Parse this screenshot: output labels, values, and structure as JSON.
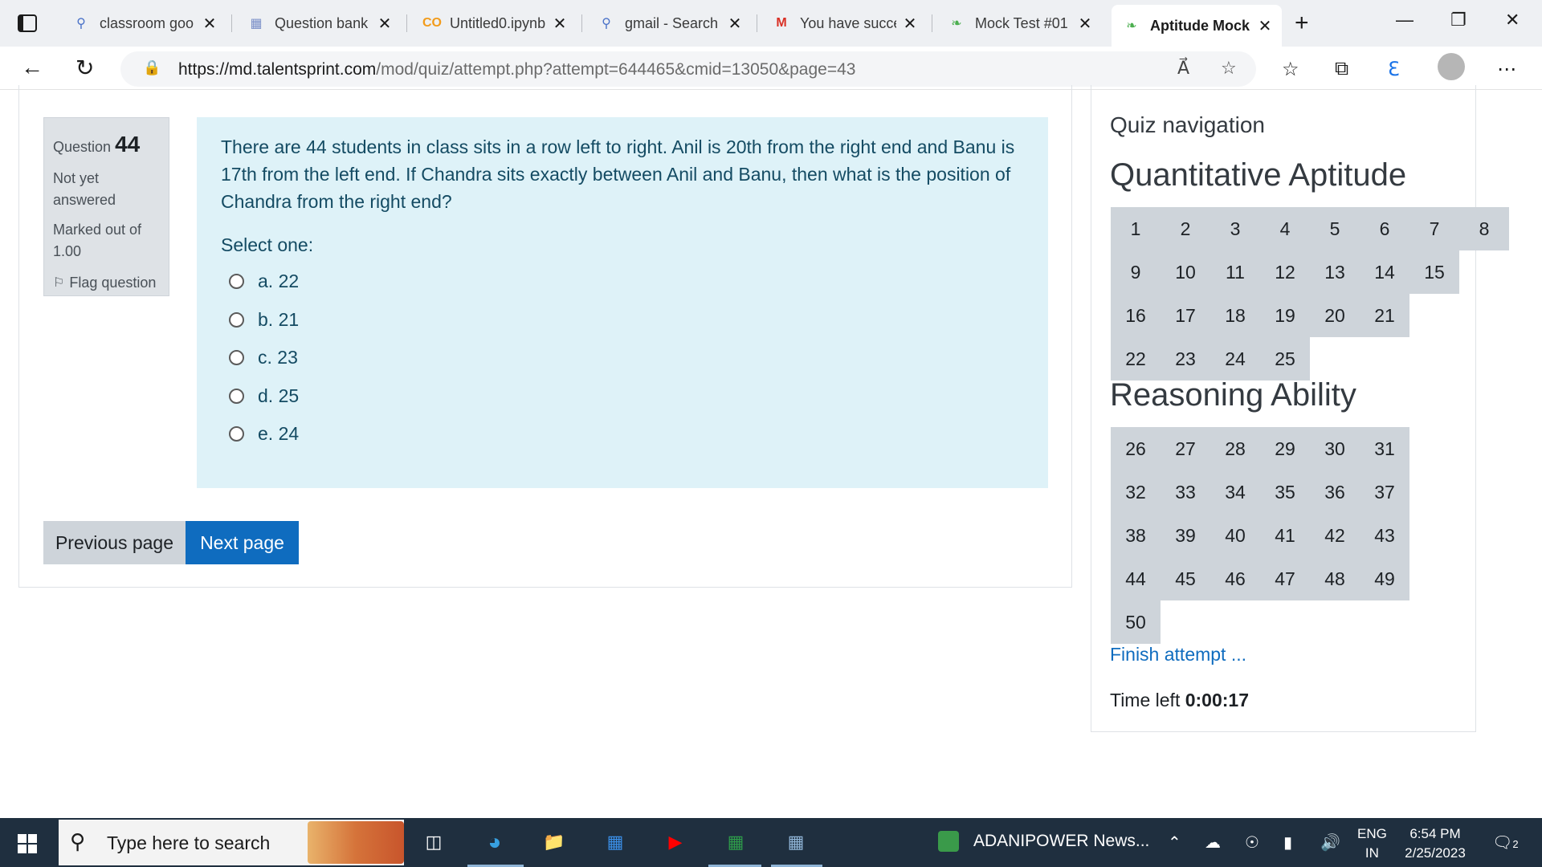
{
  "browser": {
    "tabs": [
      {
        "icon": "search-icon",
        "label": "classroom goo",
        "active": false
      },
      {
        "icon": "question-bank-icon",
        "label": "Question bank",
        "active": false
      },
      {
        "icon": "colab-icon",
        "label": "Untitled0.ipynb",
        "active": false
      },
      {
        "icon": "search-icon",
        "label": "gmail - Search",
        "active": false
      },
      {
        "icon": "gmail-icon",
        "label": "You have succe",
        "active": false
      },
      {
        "icon": "talentsprint-icon",
        "label": "Mock Test #01",
        "active": false
      },
      {
        "icon": "talentsprint-icon",
        "label": "Aptitude Mock",
        "active": true
      }
    ],
    "url_host": "https://md.talentsprint.com",
    "url_path": "/mod/quiz/attempt.php?attempt=644465&cmid=13050&page=43"
  },
  "question": {
    "label": "Question",
    "number": "44",
    "status": "Not yet answered",
    "marked": "Marked out of 1.00",
    "flag_label": "Flag question",
    "text": "There are 44 students in class sits in a row left to right. Anil is 20th from the right end and Banu is 17th from the left end. If Chandra sits exactly between Anil and Banu, then what is the position of Chandra from the right end?",
    "prompt": "Select one:",
    "answers": [
      "a. 22",
      "b. 21",
      "c. 23",
      "d. 25",
      "e. 24"
    ]
  },
  "buttons": {
    "previous": "Previous page",
    "next": "Next page"
  },
  "quiz_nav": {
    "title": "Quiz navigation",
    "sections": [
      {
        "title": "Quantitative Aptitude",
        "rows": [
          [
            "1",
            "2",
            "3",
            "4",
            "5",
            "6",
            "7",
            "8"
          ],
          [
            "9",
            "10",
            "11",
            "12",
            "13",
            "14",
            "15"
          ],
          [
            "16",
            "17",
            "18",
            "19",
            "20",
            "21"
          ],
          [
            "22",
            "23",
            "24",
            "25"
          ]
        ]
      },
      {
        "title": "Reasoning Ability",
        "rows": [
          [
            "26",
            "27",
            "28",
            "29",
            "30",
            "31"
          ],
          [
            "32",
            "33",
            "34",
            "35",
            "36",
            "37"
          ],
          [
            "38",
            "39",
            "40",
            "41",
            "42",
            "43"
          ],
          [
            "44",
            "45",
            "46",
            "47",
            "48",
            "49"
          ],
          [
            "50"
          ]
        ]
      }
    ],
    "finish": "Finish attempt ...",
    "time_label": "Time left",
    "time_value": "0:00:17"
  },
  "taskbar": {
    "search_placeholder": "Type here to search",
    "news": "ADANIPOWER News...",
    "lang_line1": "ENG",
    "lang_line2": "IN",
    "time": "6:54 PM",
    "date": "2/25/2023",
    "notification_count": "2"
  }
}
